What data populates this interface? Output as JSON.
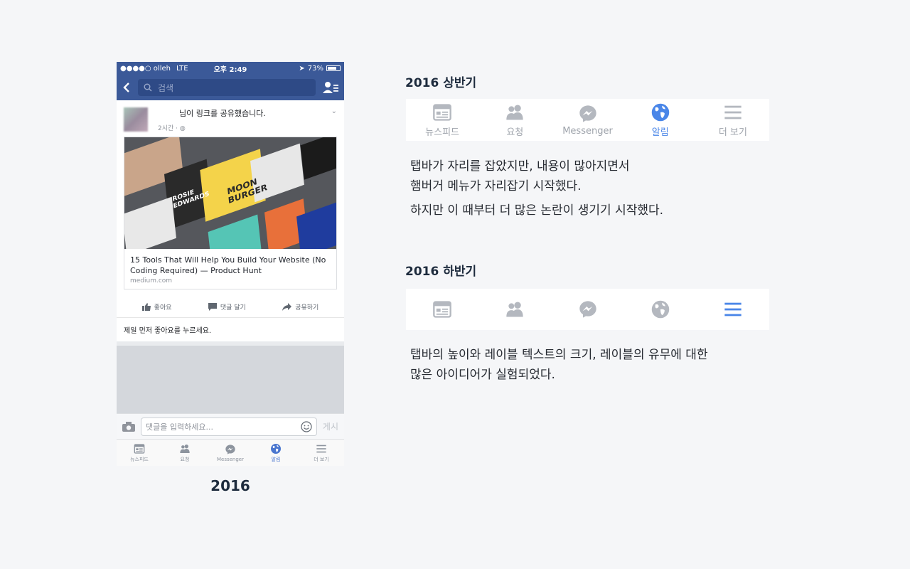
{
  "phone": {
    "status": {
      "carrier": "●●●●○ olleh",
      "network": "LTE",
      "time": "오후 2:49",
      "battery": "73%"
    },
    "search_placeholder": "검색",
    "post": {
      "header_text": "님이 링크를 공유했습니다.",
      "time": "2시간 · ",
      "link_title": "15 Tools That Will Help You Build Your Website (No Coding Required) — Product Hunt",
      "link_domain": "medium.com",
      "image_texts": [
        "MOON BURGER",
        "ROSIE EDWARDS"
      ]
    },
    "actions": {
      "like": "좋아요",
      "comment": "댓글 달기",
      "share": "공유하기"
    },
    "first_like_prompt": "제일 먼저 좋아요를 누르세요.",
    "comment_placeholder": "댓글을 입력하세요...",
    "post_button": "게시",
    "tabs": [
      {
        "label": "뉴스피드",
        "icon": "newsfeed-icon"
      },
      {
        "label": "요청",
        "icon": "friends-icon"
      },
      {
        "label": "Messenger",
        "icon": "messenger-icon"
      },
      {
        "label": "알림",
        "icon": "globe-icon",
        "active": true
      },
      {
        "label": "더 보기",
        "icon": "menu-icon"
      }
    ]
  },
  "year_label": "2016",
  "h1_section": {
    "title": "2016 상반기",
    "tabs": [
      {
        "label": "뉴스피드",
        "icon": "newsfeed-icon"
      },
      {
        "label": "요청",
        "icon": "friends-icon"
      },
      {
        "label": "Messenger",
        "icon": "messenger-icon"
      },
      {
        "label": "알림",
        "icon": "globe-icon",
        "active": true
      },
      {
        "label": "더 보기",
        "icon": "menu-icon"
      }
    ],
    "line1": "탭바가 자리를 잡았지만, 내용이 많아지면서",
    "line2": "햄버거 메뉴가 자리잡기 시작했다.",
    "line3": "하지만 이 때부터 더 많은 논란이 생기기 시작했다."
  },
  "h2_section": {
    "title": "2016 하반기",
    "tabs": [
      {
        "icon": "newsfeed-icon"
      },
      {
        "icon": "friends-icon"
      },
      {
        "icon": "messenger-icon"
      },
      {
        "icon": "globe-icon"
      },
      {
        "icon": "menu-icon",
        "active": true
      }
    ],
    "line1": "탭바의 높이와 레이블 텍스트의 크기, 레이블의 유무에 대한",
    "line2": "많은 아이디어가 실험되었다."
  },
  "colors": {
    "facebook_blue": "#3b5998",
    "active_blue": "#4a86e8",
    "inactive_gray": "#9ea3ab"
  }
}
